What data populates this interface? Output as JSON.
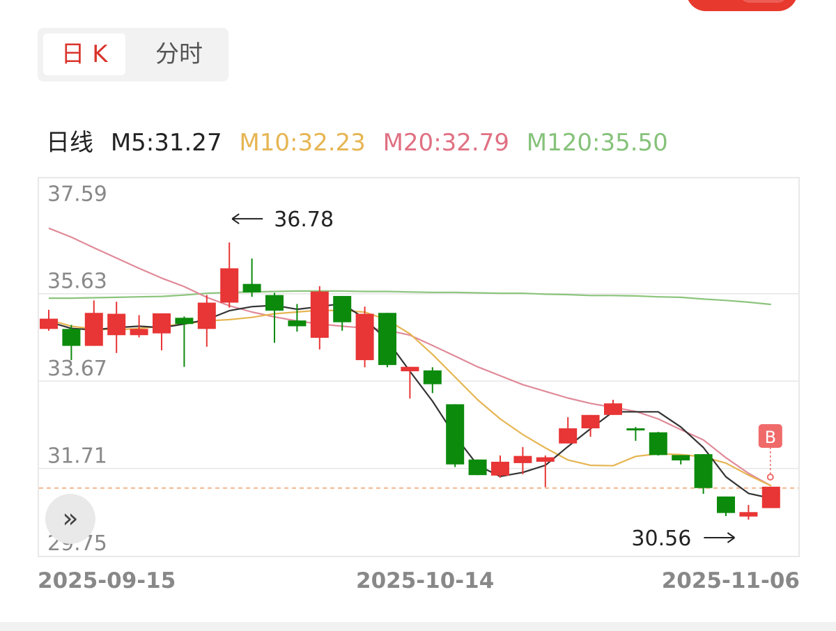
{
  "tabs": {
    "daily_k": "日 K",
    "intraday": "分时"
  },
  "legend": {
    "daily": "日线",
    "m5": "M5:31.27",
    "m10": "M10:32.23",
    "m20": "M20:32.79",
    "m120": "M120:35.50"
  },
  "buttons": {
    "expand_icon": "»"
  },
  "colors": {
    "up": "#e83535",
    "down": "#0c8a0c",
    "ma5": "#333333",
    "ma10": "#e6b552",
    "ma20": "#e08a98",
    "ma120": "#8cc47c",
    "last_price_line": "#f4b48a",
    "signal": "#f06a6a"
  },
  "chart_data": {
    "type": "candlestick",
    "y_ticks": [
      "37.59",
      "35.63",
      "33.67",
      "31.71",
      "29.75"
    ],
    "y_tick_values": [
      37.59,
      35.63,
      33.67,
      31.71,
      29.75
    ],
    "ylim": [
      29.75,
      38.22
    ],
    "x_labels": [
      {
        "label": "2025-09-15",
        "index": 0
      },
      {
        "label": "2025-10-14",
        "index": 14
      },
      {
        "label": "2025-11-06",
        "index": 32
      }
    ],
    "high_annotation": {
      "label": "36.78",
      "value": 36.78,
      "index": 8
    },
    "low_annotation": {
      "label": "30.56",
      "value": 30.56,
      "index": 31
    },
    "last_close": 31.27,
    "signal": {
      "label": "B",
      "index": 32
    },
    "candles": [
      {
        "o": 34.84,
        "c": 35.07,
        "h": 35.27,
        "l": 34.8
      },
      {
        "o": 34.84,
        "c": 34.46,
        "h": 34.93,
        "l": 34.14
      },
      {
        "o": 34.46,
        "c": 35.2,
        "h": 35.48,
        "l": 34.46
      },
      {
        "o": 34.7,
        "c": 35.18,
        "h": 35.45,
        "l": 34.3
      },
      {
        "o": 34.7,
        "c": 34.84,
        "h": 35.15,
        "l": 34.65
      },
      {
        "o": 34.74,
        "c": 35.19,
        "h": 35.19,
        "l": 34.36
      },
      {
        "o": 35.09,
        "c": 34.95,
        "h": 35.12,
        "l": 33.99
      },
      {
        "o": 34.84,
        "c": 35.43,
        "h": 35.6,
        "l": 34.44
      },
      {
        "o": 35.43,
        "c": 36.2,
        "h": 36.78,
        "l": 35.32
      },
      {
        "o": 35.85,
        "c": 35.66,
        "h": 36.42,
        "l": 35.56
      },
      {
        "o": 35.6,
        "c": 35.25,
        "h": 35.65,
        "l": 34.53
      },
      {
        "o": 35.03,
        "c": 34.9,
        "h": 35.4,
        "l": 34.78
      },
      {
        "o": 34.64,
        "c": 35.68,
        "h": 35.8,
        "l": 34.38
      },
      {
        "o": 35.58,
        "c": 34.99,
        "h": 35.58,
        "l": 34.8
      },
      {
        "o": 34.14,
        "c": 35.18,
        "h": 35.34,
        "l": 33.98
      },
      {
        "o": 35.2,
        "c": 34.03,
        "h": 35.2,
        "l": 33.98
      },
      {
        "o": 33.89,
        "c": 33.99,
        "h": 33.99,
        "l": 33.28
      },
      {
        "o": 33.91,
        "c": 33.6,
        "h": 33.98,
        "l": 33.4
      },
      {
        "o": 33.15,
        "c": 31.8,
        "h": 33.15,
        "l": 31.74
      },
      {
        "o": 31.91,
        "c": 31.56,
        "h": 31.91,
        "l": 31.56
      },
      {
        "o": 31.55,
        "c": 31.86,
        "h": 32.0,
        "l": 31.5
      },
      {
        "o": 31.83,
        "c": 31.99,
        "h": 32.19,
        "l": 31.58
      },
      {
        "o": 31.86,
        "c": 31.96,
        "h": 32.0,
        "l": 31.29
      },
      {
        "o": 32.27,
        "c": 32.61,
        "h": 32.86,
        "l": 32.27
      },
      {
        "o": 32.61,
        "c": 32.91,
        "h": 32.91,
        "l": 32.42
      },
      {
        "o": 32.91,
        "c": 33.17,
        "h": 33.25,
        "l": 32.91
      },
      {
        "o": 32.61,
        "c": 32.58,
        "h": 32.64,
        "l": 32.33
      },
      {
        "o": 32.52,
        "c": 32.01,
        "h": 32.53,
        "l": 32.0
      },
      {
        "o": 32.01,
        "c": 31.89,
        "h": 32.01,
        "l": 31.8
      },
      {
        "o": 32.03,
        "c": 31.27,
        "h": 32.03,
        "l": 31.14
      },
      {
        "o": 31.08,
        "c": 30.71,
        "h": 31.08,
        "l": 30.64
      },
      {
        "o": 30.63,
        "c": 30.73,
        "h": 30.89,
        "l": 30.56
      },
      {
        "o": 30.82,
        "c": 31.3,
        "h": 31.3,
        "l": 30.82
      }
    ],
    "ma5": [
      35.0,
      34.85,
      34.82,
      34.87,
      34.9,
      34.87,
      34.95,
      35.05,
      35.25,
      35.34,
      35.37,
      35.28,
      35.34,
      35.41,
      35.07,
      34.58,
      33.89,
      33.22,
      32.44,
      31.78,
      31.53,
      31.62,
      31.78,
      32.2,
      32.6,
      32.98,
      32.98,
      32.98,
      32.64,
      32.18,
      31.52,
      31.15,
      31.04
    ],
    "ma10": [
      35.05,
      34.9,
      34.84,
      34.82,
      34.85,
      34.9,
      34.95,
      35.02,
      35.05,
      35.1,
      35.18,
      35.22,
      35.26,
      35.25,
      35.22,
      35.04,
      34.73,
      34.27,
      33.76,
      33.25,
      32.82,
      32.47,
      32.17,
      31.9,
      31.78,
      31.77,
      31.98,
      32.04,
      32.02,
      31.97,
      31.83,
      31.56,
      31.32
    ],
    "ma20": [
      37.1,
      36.9,
      36.66,
      36.43,
      36.2,
      35.98,
      35.79,
      35.55,
      35.36,
      35.22,
      35.11,
      35.02,
      34.95,
      34.9,
      34.86,
      34.81,
      34.7,
      34.47,
      34.23,
      33.99,
      33.79,
      33.59,
      33.44,
      33.29,
      33.17,
      33.08,
      32.99,
      32.82,
      32.58,
      32.35,
      31.95,
      31.6,
      31.32
    ],
    "ma120": [
      35.53,
      35.53,
      35.54,
      35.55,
      35.56,
      35.57,
      35.6,
      35.64,
      35.66,
      35.67,
      35.68,
      35.69,
      35.69,
      35.69,
      35.68,
      35.68,
      35.67,
      35.66,
      35.66,
      35.65,
      35.64,
      35.64,
      35.62,
      35.61,
      35.59,
      35.59,
      35.58,
      35.56,
      35.55,
      35.51,
      35.48,
      35.44,
      35.39
    ]
  }
}
